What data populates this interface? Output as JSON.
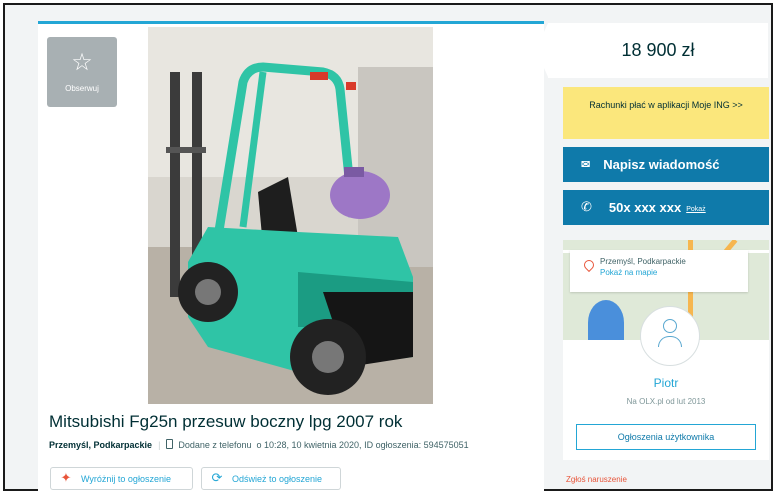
{
  "listing": {
    "observe_label": "Obserwuj",
    "title": "Mitsubishi Fg25n przesuw boczny lpg 2007 rok",
    "location": "Przemyśl, Podkarpackie",
    "added_info": "Dodane z telefonu",
    "added_date": "o 10:28, 10 kwietnia 2020, ID ogłoszenia: 594575051",
    "promote_label": "Wyróżnij to ogłoszenie",
    "refresh_label": "Odśwież to ogłoszenie"
  },
  "sidebar": {
    "price": "18 900 zł",
    "ing_banner": "Rachunki płać w aplikacji Moje ING >>",
    "message_button": "Napisz wiadomość",
    "phone_number": "50x xxx xxx",
    "phone_show": "Pokaż",
    "map_location": "Przemyśl, Podkarpackie",
    "map_link": "Pokaż na mapie",
    "user_name": "Piotr",
    "user_since": "Na OLX.pl od lut 2013",
    "user_ads_button": "Ogłoszenia użytkownika",
    "report_link": "Zgłoś naruszenie"
  },
  "colors": {
    "accent": "#23a6d5",
    "button": "#0f7aaa",
    "banner": "#fbe77c",
    "forklift": "#2fc4a6"
  }
}
